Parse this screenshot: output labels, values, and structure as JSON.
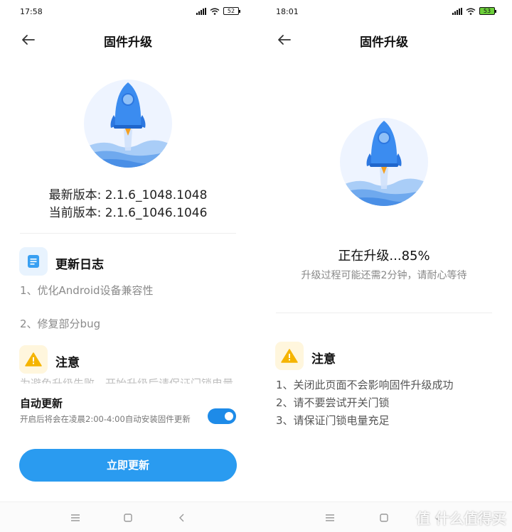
{
  "left": {
    "status": {
      "time": "17:58",
      "battery": "52"
    },
    "title": "固件升级",
    "latest_version": "最新版本: 2.1.6_1048.1048",
    "current_version": "当前版本: 2.1.6_1046.1046",
    "changelog": {
      "title": "更新日志",
      "items": [
        "1、优化Android设备兼容性",
        "2、修复部分bug"
      ]
    },
    "notice": {
      "title": "注意",
      "clipped_text": "为避免升级失败，开始升级后请保证门锁电量"
    },
    "auto_update": {
      "title": "自动更新",
      "desc": "开启后将会在凌晨2:00-4:00自动安装固件更新",
      "enabled": true
    },
    "update_button": "立即更新"
  },
  "right": {
    "status": {
      "time": "18:01",
      "battery": "53"
    },
    "title": "固件升级",
    "progress_percent": 85,
    "progress_text": "正在升级...85%",
    "progress_desc": "升级过程可能还需2分钟，请耐心等待",
    "notice": {
      "title": "注意",
      "items": [
        "1、关闭此页面不会影响固件升级成功",
        "2、请不要尝试开关门锁",
        "3、请保证门锁电量充足"
      ]
    }
  },
  "watermark": "值 什么值得买",
  "colors": {
    "accent": "#2a9bf0",
    "rocket": "#3b8cf0",
    "warning": "#f5b400"
  }
}
